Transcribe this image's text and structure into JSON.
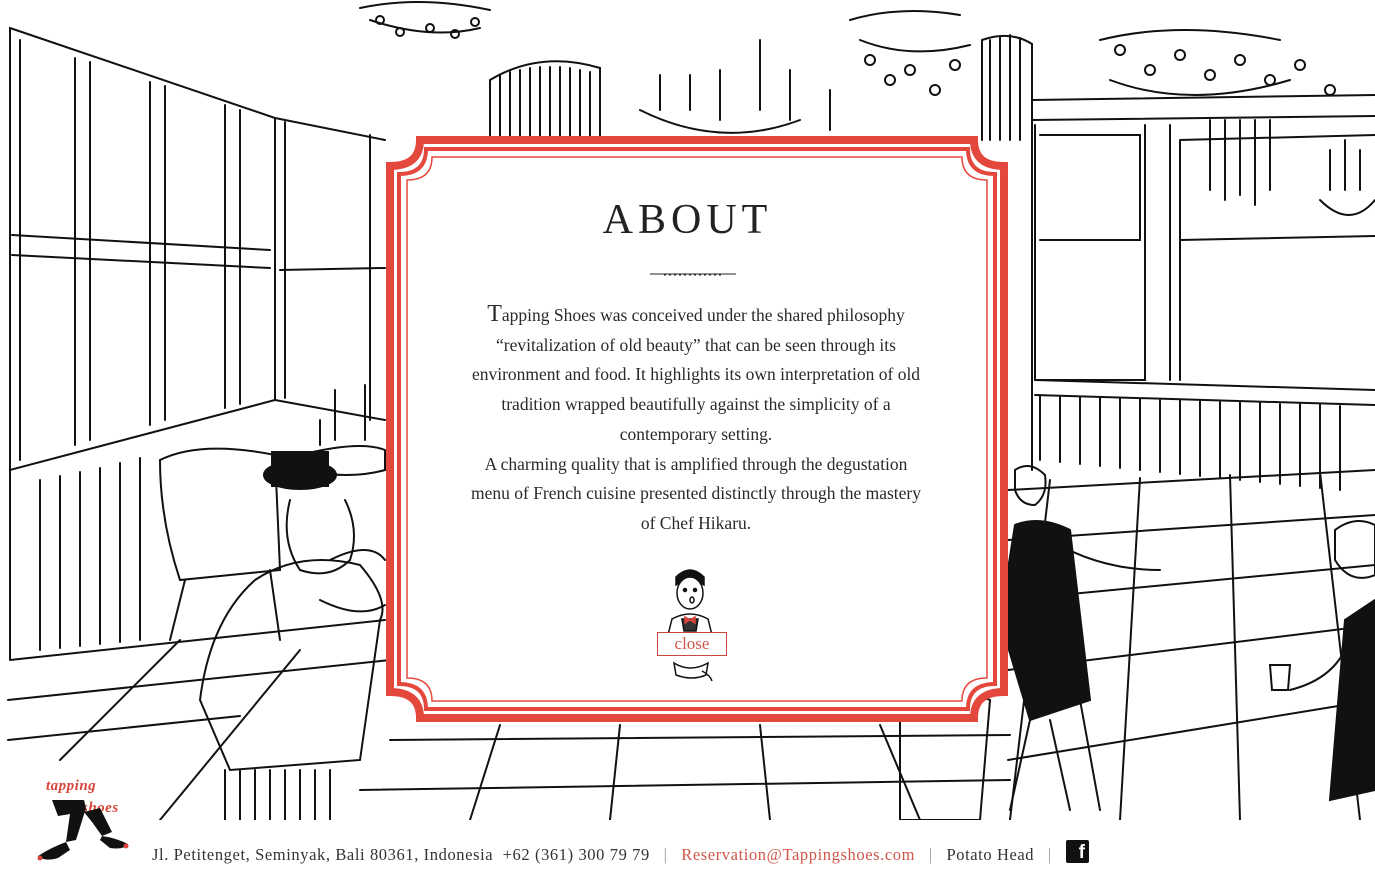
{
  "about": {
    "title": "ABOUT",
    "paragraph_first_letter": "T",
    "paragraph_rest": "apping Shoes was conceived under the shared philosophy “revitalization of old beauty” that can be seen through its environment and food. It highlights its own interpretation of old tradition wrapped beautifully against the simplicity of a contemporary setting.",
    "paragraph_2": "A charming quality that is amplified through the degustation menu of French cuisine presented distinctly through the mastery of Chef Hikaru.",
    "close_label": "close"
  },
  "logo": {
    "line1": "tapping",
    "line2": "shoes"
  },
  "footer": {
    "address": "Jl. Petitenget, Seminyak,  Bali 80361, Indonesia",
    "phone": "+62 (361) 300 79 79",
    "separator": "|",
    "email": "Reservation@Tappingshoes.com",
    "partner": "Potato Head",
    "facebook_glyph": "f"
  },
  "colors": {
    "accent_red": "#d8453a",
    "frame_red": "#e4483d",
    "ink": "#111111"
  },
  "icons": [
    "facebook-icon",
    "logo-legs-icon",
    "close-mascot-icon"
  ]
}
